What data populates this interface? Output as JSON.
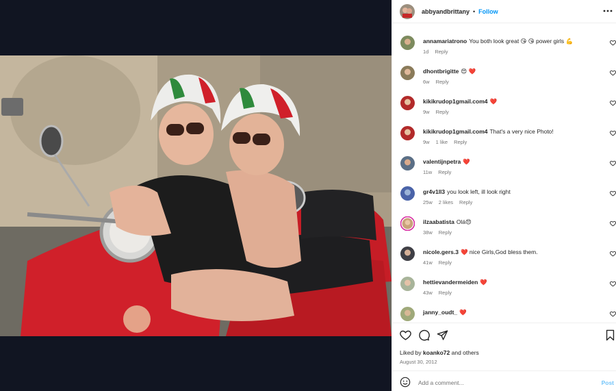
{
  "post": {
    "author": "abbyandbrittany",
    "separator": "•",
    "follow_label": "Follow",
    "more_icon": "more-horizontal-icon"
  },
  "comments": [
    {
      "user": "annamariatrono",
      "text": "You both look great 😘 😘 power girls 💪",
      "time": "1d",
      "likes": "",
      "reply": "Reply"
    },
    {
      "user": "dhontbrigitte",
      "text": "😍 ❤️",
      "time": "6w",
      "likes": "",
      "reply": "Reply"
    },
    {
      "user": "kikikrudop1gmail.com4",
      "text": "❤️",
      "time": "9w",
      "likes": "",
      "reply": "Reply"
    },
    {
      "user": "kikikrudop1gmail.com4",
      "text": "That's a very nice Photo!",
      "time": "9w",
      "likes": "1 like",
      "reply": "Reply"
    },
    {
      "user": "valentijnpetra",
      "text": "❤️",
      "time": "11w",
      "likes": "",
      "reply": "Reply"
    },
    {
      "user": "gr4v1ll3",
      "text": "you look left, ill look right",
      "time": "25w",
      "likes": "2 likes",
      "reply": "Reply"
    },
    {
      "user": "ilzaabatista",
      "text": "Olá😍",
      "time": "38w",
      "likes": "",
      "reply": "Reply"
    },
    {
      "user": "nicole.gers.3",
      "text": "❤️ nice Girls,God bless them.",
      "time": "41w",
      "likes": "",
      "reply": "Reply"
    },
    {
      "user": "hettievandermeiden",
      "text": "❤️",
      "time": "43w",
      "likes": "",
      "reply": "Reply"
    },
    {
      "user": "janny_oudt_",
      "text": "❤️",
      "time": "",
      "likes": "",
      "reply": ""
    }
  ],
  "actions": {
    "liked_prefix": "Liked by",
    "liked_user": "koanko72",
    "liked_suffix": "and others",
    "date": "August 30, 2012"
  },
  "composer": {
    "placeholder": "Add a comment...",
    "post_label": "Post"
  },
  "colors": {
    "accent": "#0095f6",
    "heart": "#ed4956",
    "text": "#262626",
    "muted": "#737373"
  }
}
